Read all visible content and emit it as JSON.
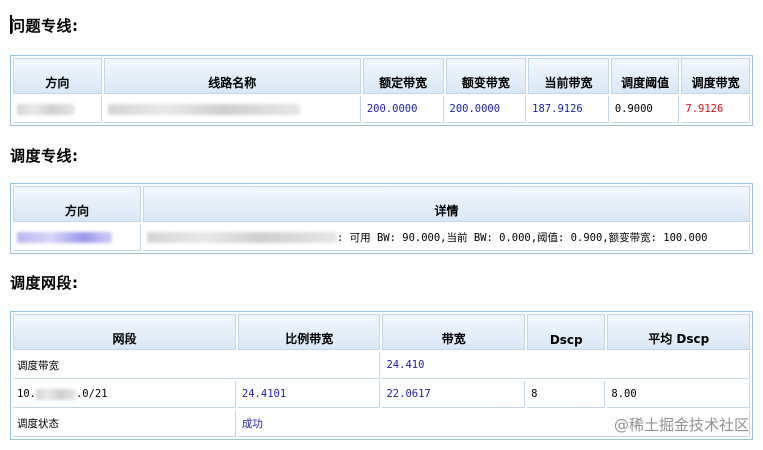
{
  "section1": {
    "title": "问题专线:",
    "headers": [
      "方向",
      "线路名称",
      "额定带宽",
      "额变带宽",
      "当前带宽",
      "调度阈值",
      "调度带宽"
    ],
    "row": {
      "rated": "200.0000",
      "changed": "200.0000",
      "current": "187.9126",
      "threshold": "0.9000",
      "sched": "7.9126"
    }
  },
  "section2": {
    "title": "调度专线:",
    "headers": [
      "方向",
      "详情"
    ],
    "row": {
      "detail": ": 可用 BW: 90.000,当前 BW: 0.000,阈值: 0.900,额变带宽: 100.000"
    }
  },
  "section3": {
    "title": "调度网段:",
    "headers": [
      "网段",
      "比例带宽",
      "带宽",
      "Dscp",
      "平均 Dscp"
    ],
    "rows": {
      "sched_bw_label": "调度带宽",
      "sched_bw_value": "24.410",
      "ip_prefix": "10.",
      "ip_suffix": ".0/21",
      "ratio_bw": "24.4101",
      "bw": "22.0617",
      "dscp": "8",
      "avg_dscp": "8.00",
      "status_label": "调度状态",
      "status_value": "成功"
    }
  },
  "watermark": "@稀土掘金技术社区"
}
